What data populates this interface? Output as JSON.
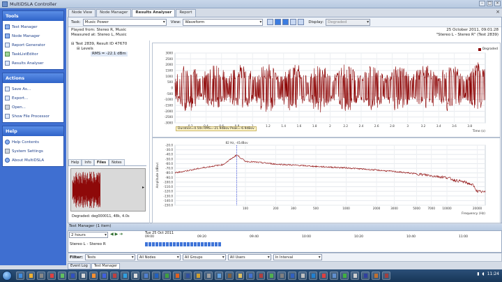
{
  "window": {
    "title": "MultiDSLA Controller"
  },
  "sidebar": {
    "tools": {
      "title": "Tools",
      "items": [
        "Test Manager",
        "Node Manager",
        "Report Generator",
        "TaskListEditor",
        "Results Analyser"
      ]
    },
    "actions": {
      "title": "Actions",
      "items": [
        "Save As...",
        "Export...",
        "Open...",
        "Show File Processor"
      ]
    },
    "help": {
      "title": "Help",
      "items": [
        "Help Contents",
        "System Settings",
        "About MultiDSLA"
      ]
    }
  },
  "tabs": [
    "Node View",
    "Node Manager",
    "Results Analyser",
    "Report"
  ],
  "toolbar": {
    "task_label": "Task:",
    "task_value": "Music Power",
    "view_label": "View:",
    "view_value": "Waveform",
    "display_label": "Display:",
    "display_value": "Degraded"
  },
  "info": {
    "played_from": "Played from: Stereo R, Music",
    "measured_at": "Measured at: Stereo L, Music",
    "date": "25 October 2011, 09:01:28",
    "test_name": "\"Stereo L - Stereo R\" (Test 2839)"
  },
  "tree": {
    "test": "Test 2839, Result ID 47670",
    "levels": "Levels",
    "rms": "RMS = -22.1 dBm"
  },
  "subtabs": [
    "Help",
    "Info",
    "Files",
    "Notes"
  ],
  "files": {
    "thumb_label": "Degraded: deg000011, 48k, 4.0s"
  },
  "chart_data": [
    {
      "type": "line",
      "series": [
        {
          "name": "Degraded",
          "color": "#8b0000"
        }
      ],
      "xlabel": "Time (s)",
      "ylabel": "",
      "x_ticks": [
        0.2,
        0.4,
        0.6,
        0.8,
        1,
        1.2,
        1.4,
        1.6,
        1.8,
        2,
        2.2,
        2.4,
        2.6,
        2.8,
        3,
        3.2,
        3.4,
        3.6,
        3.8
      ],
      "y_ticks": [
        3000,
        2500,
        2000,
        1500,
        1000,
        500,
        0,
        -500,
        -1000,
        -1500,
        -2000,
        -2500,
        -3000
      ],
      "ylim": [
        -3000,
        3000
      ],
      "xlim": [
        0,
        4
      ],
      "legend": "top-right",
      "status": "Duration=0.50s   RMS=-21.9dBov   Peak=-6.9dBov"
    },
    {
      "type": "line",
      "series": [
        {
          "name": "Degraded",
          "color": "#8b0000"
        }
      ],
      "xlabel": "Frequency (Hz)",
      "ylabel": "Amplitude (dBov)",
      "x_ticks": [
        100,
        200,
        300,
        500,
        1000,
        2000,
        3000,
        5000,
        7000,
        10000,
        20000
      ],
      "y_ticks": [
        -20,
        -30,
        -40,
        -50,
        -60,
        -70,
        -80,
        -90,
        -100,
        -110,
        -120,
        -130,
        -140,
        -150
      ],
      "ylim": [
        -150,
        -20
      ],
      "xlim": [
        20,
        24000
      ],
      "cursor": "82 Hz, -41dBov",
      "points": [
        [
          20,
          -80
        ],
        [
          40,
          -68
        ],
        [
          60,
          -62
        ],
        [
          82,
          -41
        ],
        [
          100,
          -55
        ],
        [
          150,
          -58
        ],
        [
          200,
          -61
        ],
        [
          300,
          -63
        ],
        [
          500,
          -66
        ],
        [
          1000,
          -69
        ],
        [
          2000,
          -74
        ],
        [
          3000,
          -77
        ],
        [
          5000,
          -82
        ],
        [
          7000,
          -86
        ],
        [
          10000,
          -90
        ],
        [
          12000,
          -96
        ],
        [
          15000,
          -100
        ],
        [
          18000,
          -106
        ],
        [
          20000,
          -120
        ],
        [
          24000,
          -122
        ]
      ]
    }
  ],
  "test_manager": {
    "title": "Test Manager (1 item)",
    "range": "2 hours",
    "date": "Tue 25 Oct 2011",
    "times": [
      "09:00",
      "09:20",
      "09:40",
      "10:00",
      "10:20",
      "10:40",
      "11:00"
    ],
    "row_name": "Stereo L - Stereo R"
  },
  "filters": {
    "label": "Filter:",
    "values": [
      "Tests",
      "All Nodes",
      "All Groups",
      "All Users",
      "In Interval"
    ]
  },
  "bottom_tabs": [
    "Event Log",
    "Test Manager"
  ],
  "taskbar": {
    "clock": "11:24"
  }
}
